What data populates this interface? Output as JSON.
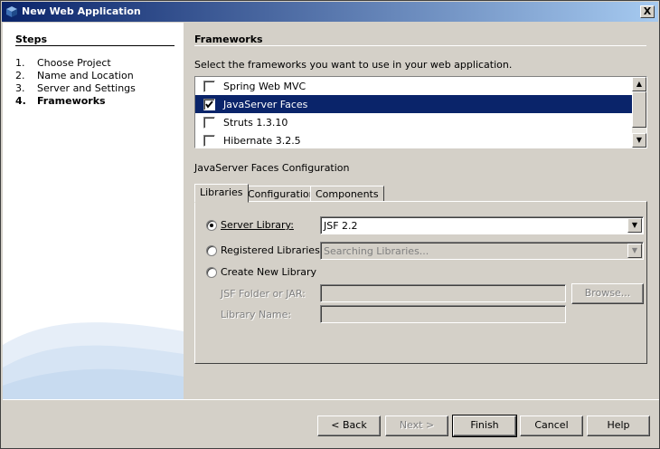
{
  "window": {
    "title": "New Web Application",
    "close_glyph": "X"
  },
  "steps": {
    "heading": "Steps",
    "items": [
      {
        "num": "1.",
        "label": "Choose Project"
      },
      {
        "num": "2.",
        "label": "Name and Location"
      },
      {
        "num": "3.",
        "label": "Server and Settings"
      },
      {
        "num": "4.",
        "label": "Frameworks"
      }
    ]
  },
  "frameworks": {
    "heading": "Frameworks",
    "instruction": "Select the frameworks you want to use in your web application.",
    "items": [
      {
        "label": "Spring Web MVC",
        "checked": false,
        "selected": false
      },
      {
        "label": "JavaServer Faces",
        "checked": true,
        "selected": true
      },
      {
        "label": "Struts 1.3.10",
        "checked": false,
        "selected": false
      },
      {
        "label": "Hibernate 3.2.5",
        "checked": false,
        "selected": false
      }
    ]
  },
  "config": {
    "label": "JavaServer Faces Configuration",
    "tabs": [
      "Libraries",
      "Configuration",
      "Components"
    ],
    "active_tab": "Libraries",
    "server_library": {
      "label": "Server Library:",
      "value": "JSF 2.2",
      "selected": true
    },
    "registered_libraries": {
      "label": "Registered Libraries:",
      "value": "Searching Libraries..."
    },
    "create_new_library": {
      "label": "Create New Library"
    },
    "jsf_folder": {
      "label": "JSF Folder or JAR:",
      "value": ""
    },
    "library_name": {
      "label": "Library Name:",
      "value": ""
    },
    "browse_label": "Browse..."
  },
  "buttons": {
    "back": "< Back",
    "next": "Next >",
    "finish": "Finish",
    "cancel": "Cancel",
    "help": "Help"
  },
  "icons": {
    "app": "netbeans-cube-icon",
    "checked": "checkmark-icon"
  },
  "colors": {
    "title_bar_start": "#0a246a",
    "title_bar_end": "#a6caf0",
    "selection": "#0a246a",
    "dialog_face": "#d4d0c8"
  }
}
